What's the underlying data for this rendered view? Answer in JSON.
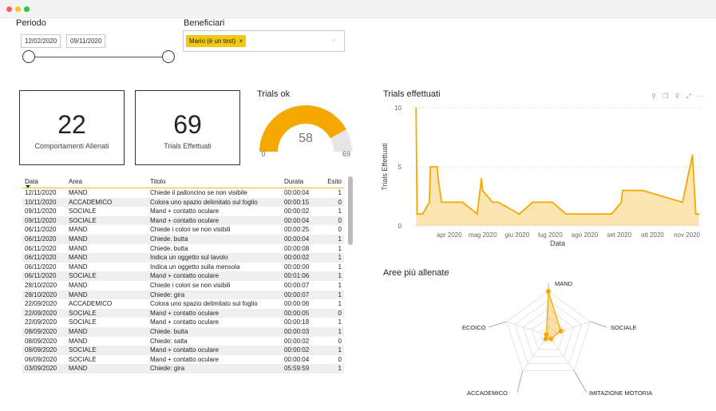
{
  "filters": {
    "periodo_label": "Periodo",
    "date_start": "12/02/2020",
    "date_end": "09/11/2020",
    "beneficiari_label": "Beneficiari",
    "selected_beneficiario": "Mario (è un test)",
    "remove_glyph": "×",
    "dropdown_glyph": "⌵"
  },
  "cards": {
    "comportamenti_value": "22",
    "comportamenti_label": "Comportamenti Allenati",
    "trials_value": "69",
    "trials_label": "Trials Effettuati"
  },
  "gauge": {
    "title": "Trials ok",
    "value_text": "58",
    "min_text": "0",
    "max_text": "69",
    "value": 58,
    "min": 0,
    "max": 69,
    "color": "#f5a800"
  },
  "table": {
    "headers": [
      "Data",
      "Area",
      "Titolo",
      "Durata",
      "Esito"
    ],
    "rows": [
      [
        "12/11/2020",
        "MAND",
        "Chiede il palloncino se non visibile",
        "00:00:04",
        "1"
      ],
      [
        "10/11/2020",
        "ACCADEMICO",
        "Colora uno spazio delimitato sul foglio",
        "00:00:15",
        "0"
      ],
      [
        "09/11/2020",
        "SOCIALE",
        "Mand + contatto oculare",
        "00:00:02",
        "1"
      ],
      [
        "09/11/2020",
        "SOCIALE",
        "Mand + contatto oculare",
        "00:00:04",
        "0"
      ],
      [
        "06/11/2020",
        "MAND",
        "Chiede i colori se non visibili",
        "00:00:25",
        "0"
      ],
      [
        "06/11/2020",
        "MAND",
        "Chiede. butta",
        "00:00:04",
        "1"
      ],
      [
        "06/11/2020",
        "MAND",
        "Chiede. butta",
        "00:00:08",
        "1"
      ],
      [
        "06/11/2020",
        "MAND",
        "Indica un oggetto sul tavolo",
        "00:00:02",
        "1"
      ],
      [
        "06/11/2020",
        "MAND",
        "Indica un oggetto sulla mensola",
        "00:00:00",
        "1"
      ],
      [
        "06/11/2020",
        "SOCIALE",
        "Mand + contatto oculare",
        "00:01:06",
        "1"
      ],
      [
        "28/10/2020",
        "MAND",
        "Chiede i colori se non visibili",
        "00:00:07",
        "1"
      ],
      [
        "28/10/2020",
        "MAND",
        "Chiede: gira",
        "00:00:07",
        "1"
      ],
      [
        "22/09/2020",
        "ACCADEMICO",
        "Colora uno spazio delimitato sul foglio",
        "00:00:06",
        "1"
      ],
      [
        "22/09/2020",
        "SOCIALE",
        "Mand + contatto oculare",
        "00:00:05",
        "0"
      ],
      [
        "22/09/2020",
        "SOCIALE",
        "Mand + contatto oculare",
        "00:00:18",
        "1"
      ],
      [
        "08/09/2020",
        "MAND",
        "Chiede. butta",
        "00:00:03",
        "1"
      ],
      [
        "08/09/2020",
        "MAND",
        "Chiede: salta",
        "00:00:02",
        "0"
      ],
      [
        "08/09/2020",
        "SOCIALE",
        "Mand + contatto oculare",
        "00:00:02",
        "1"
      ],
      [
        "06/09/2020",
        "SOCIALE",
        "Mand + contatto oculare",
        "00:00:04",
        "0"
      ],
      [
        "03/09/2020",
        "MAND",
        "Chiede: gira",
        "05:59:59",
        "1"
      ]
    ]
  },
  "line_chart": {
    "title": "Trials effettuati",
    "toolbar_icons": [
      "pin-icon",
      "copy-icon",
      "filter-icon",
      "focus-icon",
      "more-icon"
    ],
    "toolbar_glyphs": [
      "⚲",
      "❐",
      "⊽",
      "⤢",
      "···"
    ]
  },
  "radar_chart": {
    "title": "Aree più allenate"
  },
  "chart_data": [
    {
      "type": "area",
      "title": "Trials effettuati",
      "xlabel": "Data",
      "ylabel": "Trials Effettuati",
      "ylim": [
        0,
        10
      ],
      "yticks": [
        "0",
        "5",
        "10"
      ],
      "xticks": [
        "apr 2020",
        "mag 2020",
        "giu 2020",
        "lug 2020",
        "ago 2020",
        "set 2020",
        "ott 2020",
        "nov 2020"
      ],
      "x": [
        "2020-03-02",
        "2020-03-03",
        "2020-03-08",
        "2020-03-14",
        "2020-03-15",
        "2020-03-21",
        "2020-03-22",
        "2020-03-25",
        "2020-03-29",
        "2020-04-06",
        "2020-04-13",
        "2020-04-26",
        "2020-04-30",
        "2020-05-01",
        "2020-05-10",
        "2020-05-15",
        "2020-06-03",
        "2020-06-15",
        "2020-07-03",
        "2020-07-15",
        "2020-08-15",
        "2020-08-25",
        "2020-09-03",
        "2020-09-04",
        "2020-09-22",
        "2020-10-28",
        "2020-11-06",
        "2020-11-09",
        "2020-11-12"
      ],
      "values": [
        10,
        1,
        1,
        2,
        5,
        5,
        4,
        2,
        2,
        2,
        2,
        1,
        4,
        3,
        2,
        2,
        1,
        2,
        2,
        1,
        1,
        1,
        2,
        3,
        3,
        2,
        6,
        1,
        1
      ],
      "color": "#f5a800"
    },
    {
      "type": "radar",
      "title": "Aree più allenate",
      "categories": [
        "MAND",
        "SOCIALE",
        "IMITAZIONE MOTORIA",
        "ACCADEMICO",
        "ECOICO"
      ],
      "values": [
        10,
        3,
        1,
        1,
        0
      ],
      "max": 10,
      "color": "#f5a800"
    }
  ]
}
